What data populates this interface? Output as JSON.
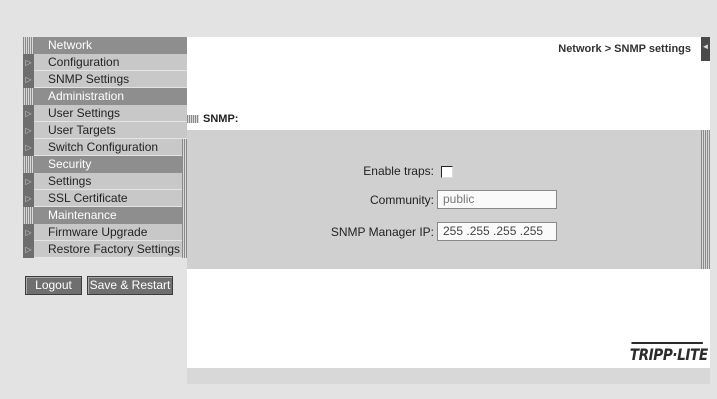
{
  "sidebar": {
    "sections": [
      {
        "title": "Network",
        "items": [
          "Configuration",
          "SNMP Settings"
        ]
      },
      {
        "title": "Administration",
        "items": [
          "User Settings",
          "User Targets",
          "Switch Configuration"
        ]
      },
      {
        "title": "Security",
        "items": [
          "Settings",
          "SSL Certificate"
        ]
      },
      {
        "title": "Maintenance",
        "items": [
          "Firmware Upgrade",
          "Restore Factory Settings"
        ]
      }
    ]
  },
  "buttons": {
    "logout": "Logout",
    "save_restart": "Save & Restart"
  },
  "header": {
    "breadcrumb": "Network > SNMP settings"
  },
  "snmp": {
    "title": "SNMP:",
    "enable_traps_label": "Enable traps:",
    "enable_traps_checked": false,
    "community_label": "Community:",
    "community_value": "public",
    "manager_ip_label": "SNMP Manager IP:",
    "manager_ip_value": "255 .255 .255 .255"
  },
  "brand": {
    "logo_text": "TRIPP·LITE"
  }
}
